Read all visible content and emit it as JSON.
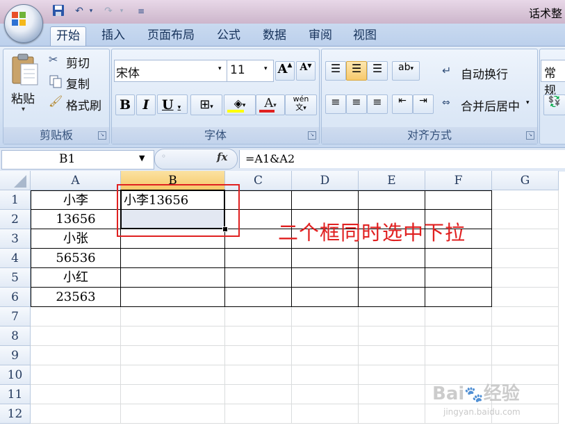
{
  "window": {
    "title": "话术整"
  },
  "tabs": [
    "开始",
    "插入",
    "页面布局",
    "公式",
    "数据",
    "审阅",
    "视图"
  ],
  "clipboard": {
    "paste": "粘贴",
    "cut": "剪切",
    "copy": "复制",
    "format_painter": "格式刷",
    "group": "剪贴板"
  },
  "font": {
    "name": "宋体",
    "size": "11",
    "bold": "B",
    "italic": "I",
    "underline": "U",
    "font_color_letter": "A",
    "group": "字体",
    "wen": "wén"
  },
  "alignment": {
    "wrap": "自动换行",
    "merge": "合并后居中",
    "group": "对齐方式"
  },
  "number": {
    "format": "常规"
  },
  "formula_bar": {
    "name_box": "B1",
    "fx": "fx",
    "formula": "=A1&A2"
  },
  "grid": {
    "columns": [
      "A",
      "B",
      "C",
      "D",
      "E",
      "F",
      "G"
    ],
    "rows": [
      "1",
      "2",
      "3",
      "4",
      "5",
      "6",
      "7",
      "8",
      "9",
      "10",
      "11",
      "12"
    ],
    "cells": {
      "A1": "小李",
      "A2": "13656",
      "A3": "小张",
      "A4": "56536",
      "A5": "小红",
      "A6": "23563",
      "B1": "小李13656"
    }
  },
  "annotation": "二个框同时选中下拉",
  "watermark": {
    "logo": "Bai du 经验",
    "url": "jingyan.baidu.com"
  },
  "colors": {
    "annotation": "#e02020",
    "selected_header": "#f6c86a",
    "selection_fill": "#e3e8f2"
  }
}
